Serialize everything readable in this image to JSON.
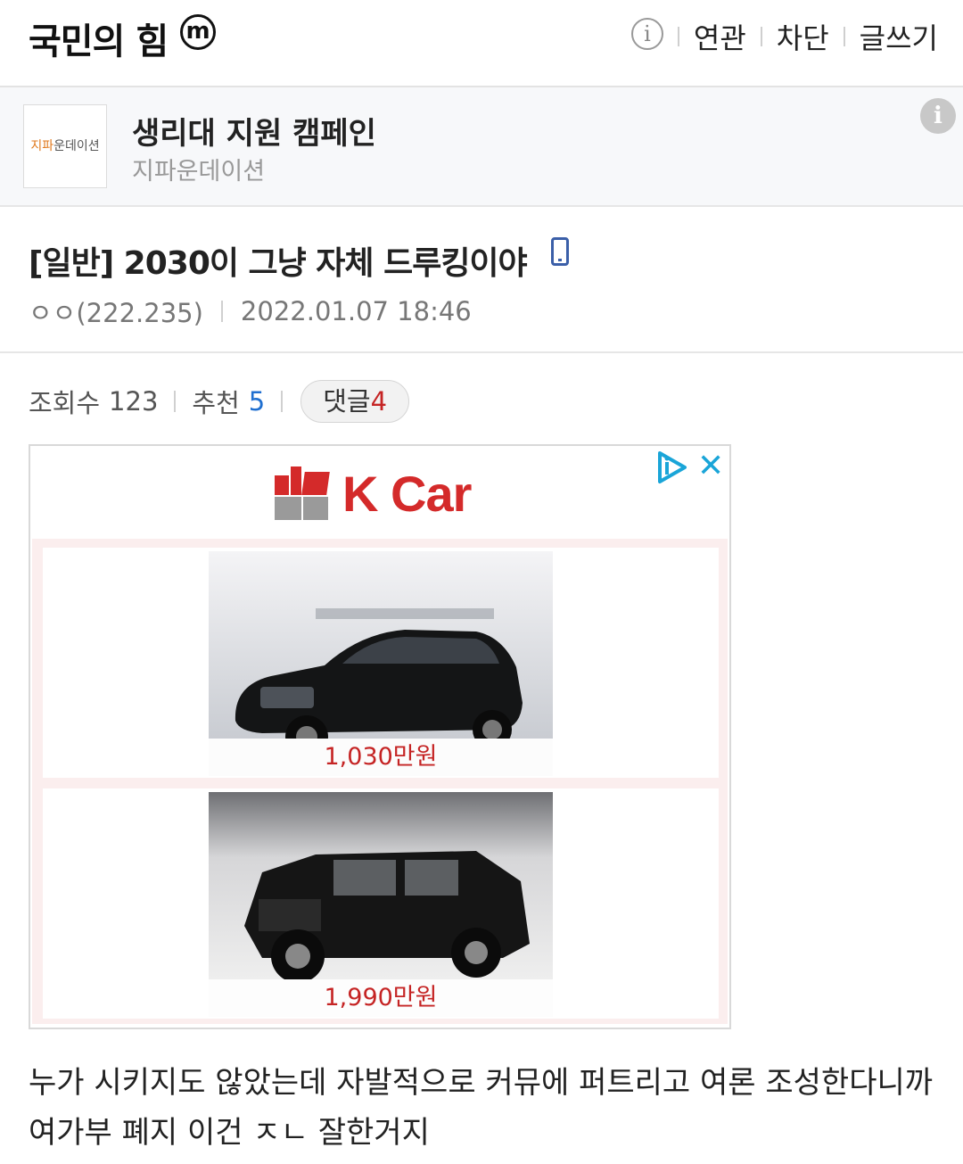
{
  "header": {
    "gallery_title": "국민의 힘",
    "minor_badge": "m",
    "info_icon": "info-icon",
    "menu": [
      "연관",
      "차단",
      "글쓰기"
    ]
  },
  "campaign": {
    "logo_text_highlight": "지파",
    "logo_text_rest": "운데이션",
    "title": "생리대 지원 캠페인",
    "subtitle": "지파운데이션"
  },
  "post": {
    "title": "[일반] 2030이 그냥 자체 드루킹이야",
    "author": "ㅇㅇ(222.235)",
    "date": "2022.01.07 18:46",
    "views_label": "조회수",
    "views": "123",
    "recommend_label": "추천",
    "recommend": "5",
    "comments_label": "댓글",
    "comments": "4",
    "body": "누가 시키지도 않았는데 자발적으로 커뮤에 퍼트리고 여론 조성한다니까 여가부 폐지 이건 ㅈㄴ 잘한거지"
  },
  "ad": {
    "brand": "K Car",
    "items": [
      {
        "price": "1,030만원"
      },
      {
        "price": "1,990만원"
      }
    ],
    "colors": {
      "brand_red": "#d42a2a",
      "brand_gray": "#9a9a9a",
      "adchoice": "#1aa5d8"
    }
  }
}
